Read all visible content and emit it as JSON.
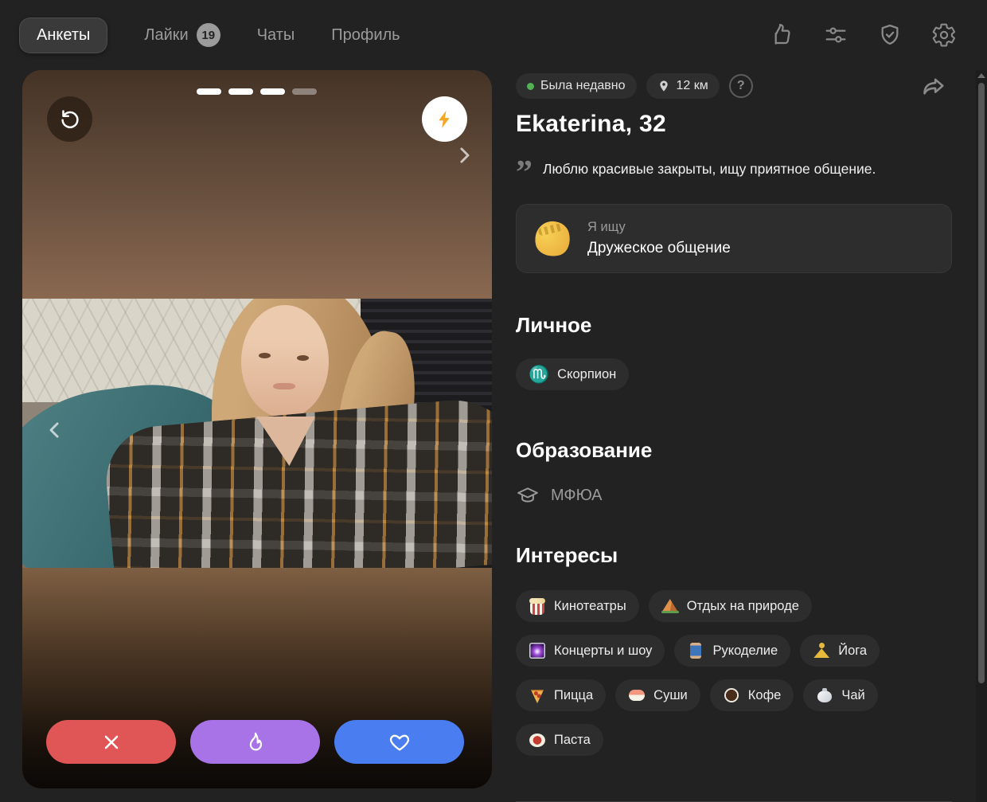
{
  "nav": {
    "tabs": [
      {
        "label": "Анкеты"
      },
      {
        "label": "Лайки",
        "badge": "19"
      },
      {
        "label": "Чаты"
      },
      {
        "label": "Профиль"
      }
    ]
  },
  "photo_card": {
    "progress": {
      "total": 4,
      "current": 3
    }
  },
  "profile": {
    "status": "Была недавно",
    "distance": "12 км",
    "name": "Ekaterina, 32",
    "quote": "Люблю красивые закрыты, ищу приятное общение.",
    "looking_for": {
      "emoji": "👋",
      "label": "Я ищу",
      "value": "Дружеское общение"
    },
    "personal": {
      "title": "Личное",
      "zodiac_symbol": "♏",
      "zodiac_label": "Скорпион"
    },
    "education": {
      "title": "Образование",
      "value": "МФЮА"
    },
    "interests": {
      "title": "Интересы",
      "chips": [
        {
          "icon": "popcorn",
          "emoji": "🍿",
          "label": "Кинотеатры"
        },
        {
          "icon": "camping",
          "emoji": "🏕️",
          "label": "Отдых на природе"
        },
        {
          "icon": "fireworks",
          "emoji": "🎆",
          "label": "Концерты и шоу"
        },
        {
          "icon": "thread",
          "emoji": "🧵",
          "label": "Рукоделие"
        },
        {
          "icon": "yoga",
          "emoji": "🧘",
          "label": "Йога"
        },
        {
          "icon": "pizza",
          "emoji": "🍕",
          "label": "Пицца"
        },
        {
          "icon": "sushi",
          "emoji": "🍣",
          "label": "Суши"
        },
        {
          "icon": "coffee",
          "emoji": "☕",
          "label": "Кофе"
        },
        {
          "icon": "teapot",
          "emoji": "🫖",
          "label": "Чай"
        },
        {
          "icon": "pasta",
          "emoji": "🍝",
          "label": "Паста"
        }
      ]
    }
  },
  "colors": {
    "page_bg": "#222222",
    "chip_bg": "#2d2d2e",
    "status_green": "#52b152",
    "action_dislike": "#e05656",
    "action_superlike": "#a873e6",
    "action_like": "#4a7ef0",
    "boost_bolt": "#f5a623"
  }
}
